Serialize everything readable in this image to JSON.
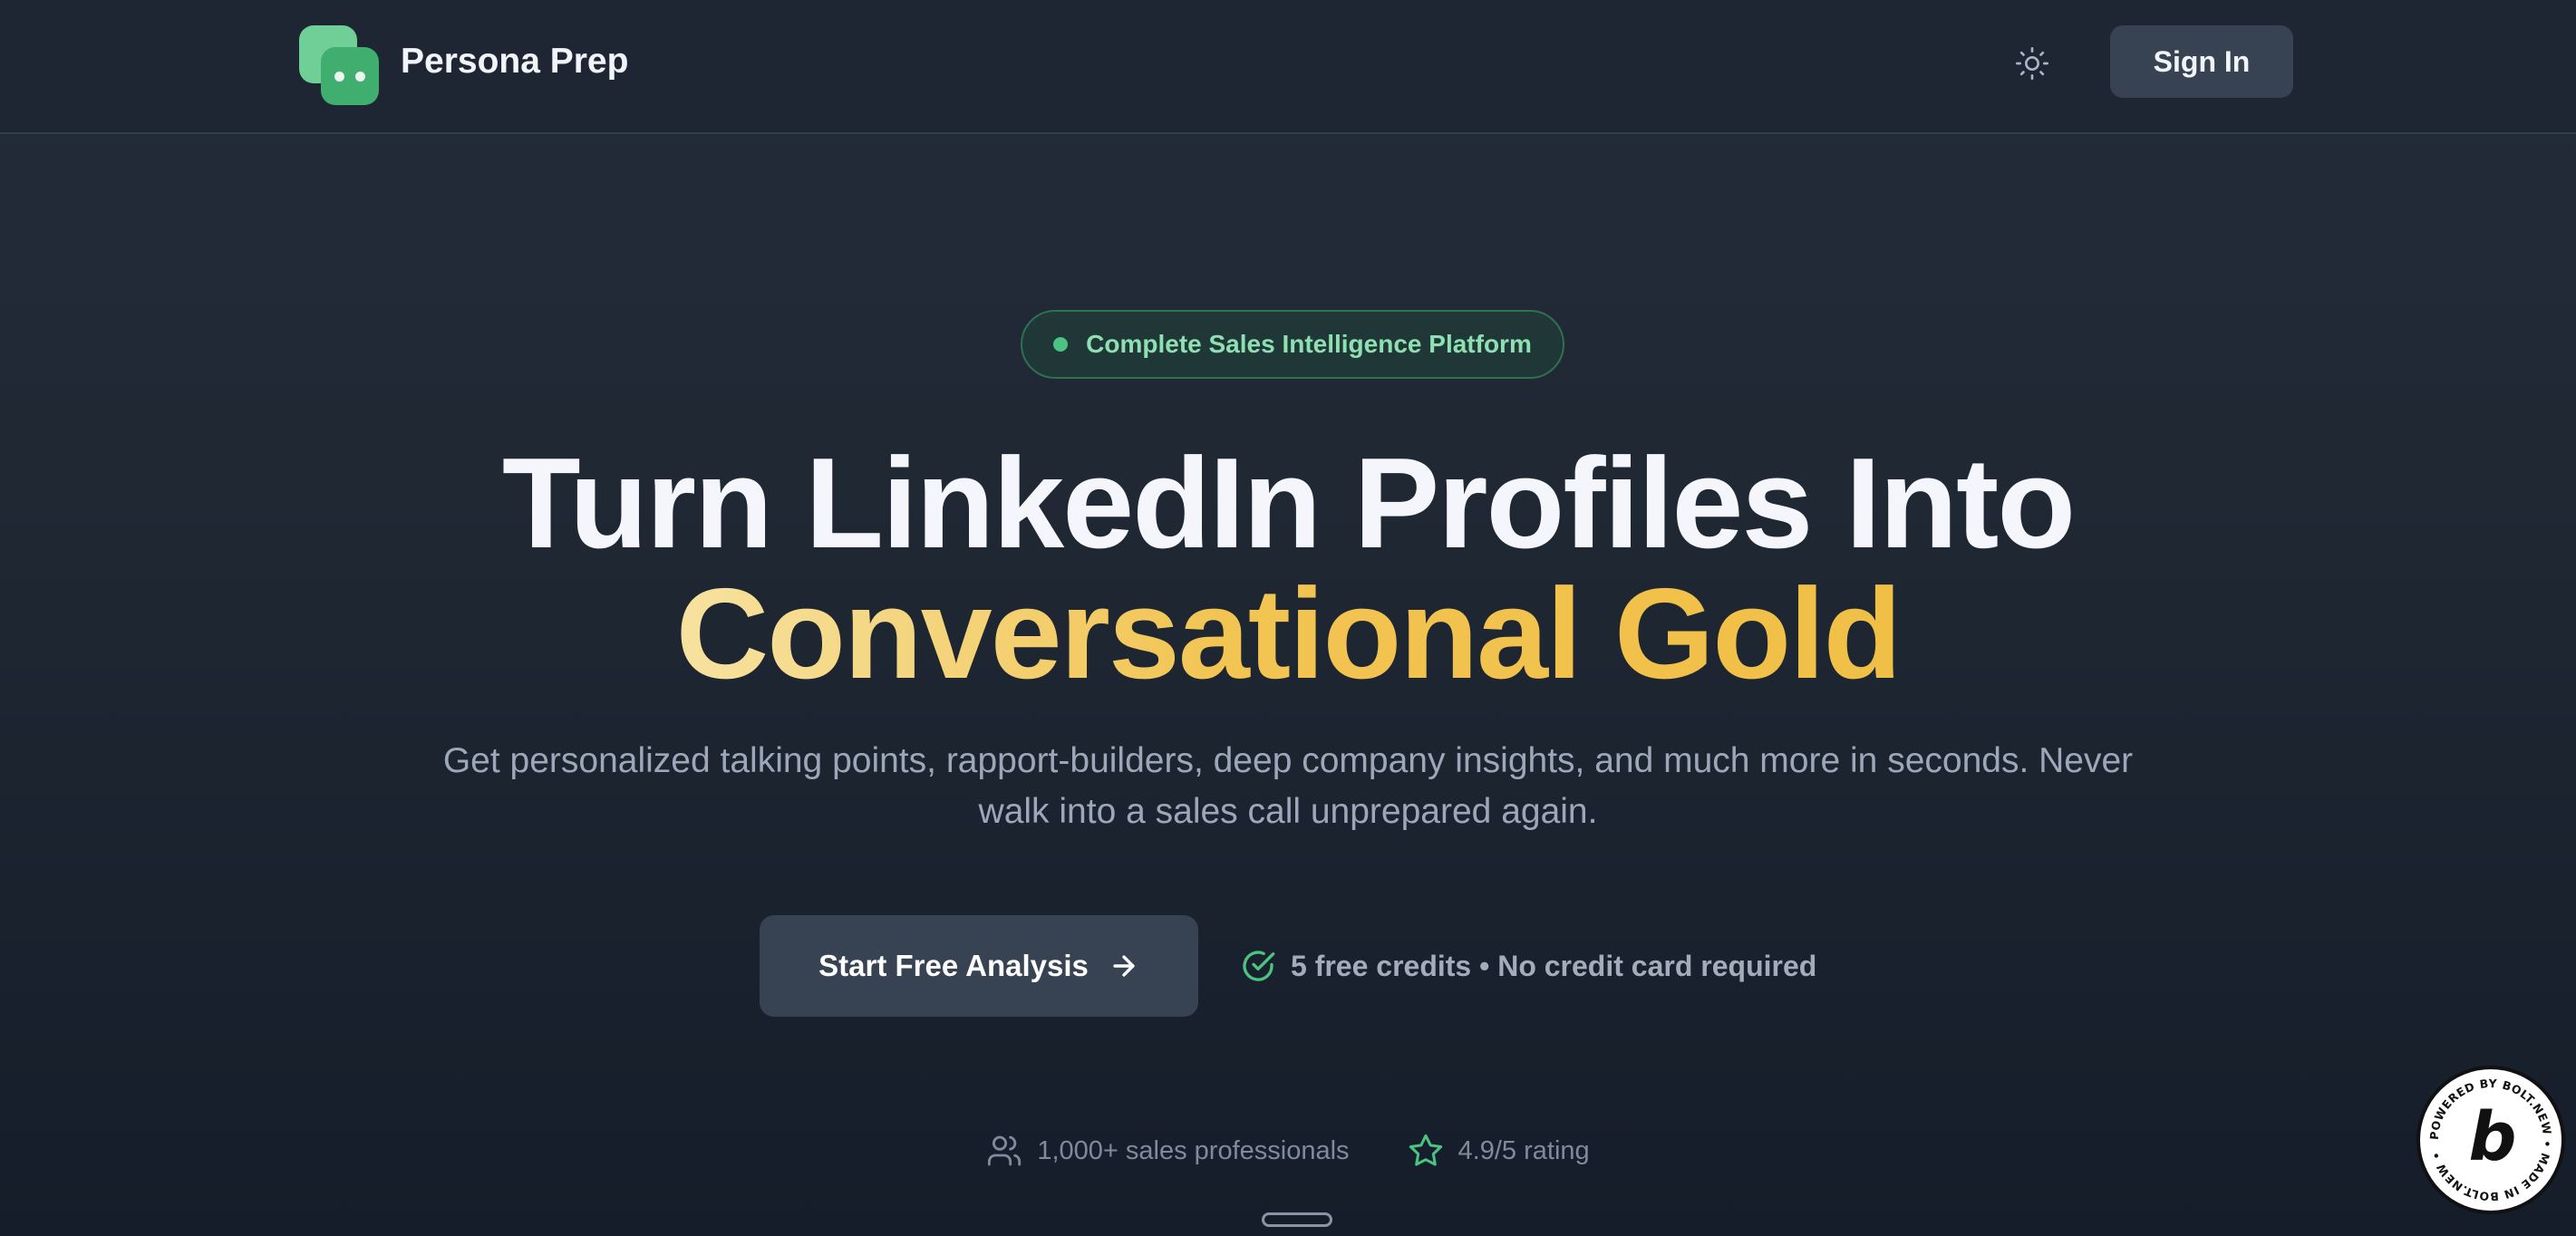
{
  "header": {
    "brand": "Persona Prep",
    "sign_in_label": "Sign In"
  },
  "hero": {
    "badge": "Complete Sales Intelligence Platform",
    "title_line1": "Turn LinkedIn Profiles Into",
    "title_line2": "Conversational Gold",
    "subtitle": "Get personalized talking points, rapport-builders, deep company insights, and much more in seconds. Never walk into a sales call unprepared again.",
    "cta_label": "Start Free Analysis",
    "credits_note": "5 free credits • No credit card required"
  },
  "stats": {
    "users": "1,000+ sales professionals",
    "rating": "4.9/5 rating"
  },
  "bolt_badge": {
    "ring_text": "POWERED BY BOLT.NEW • MADE IN BOLT.NEW •",
    "glyph": "b"
  },
  "icons": {
    "theme": "sun-icon",
    "cta": "arrow-right-icon",
    "credits": "check-circle-icon",
    "users": "users-icon",
    "rating": "star-icon"
  },
  "colors": {
    "accent_green": "#4cc283",
    "gold_gradient_start": "#f6e2a0",
    "gold_gradient_end": "#f0bf46",
    "button_bg": "#374253"
  }
}
